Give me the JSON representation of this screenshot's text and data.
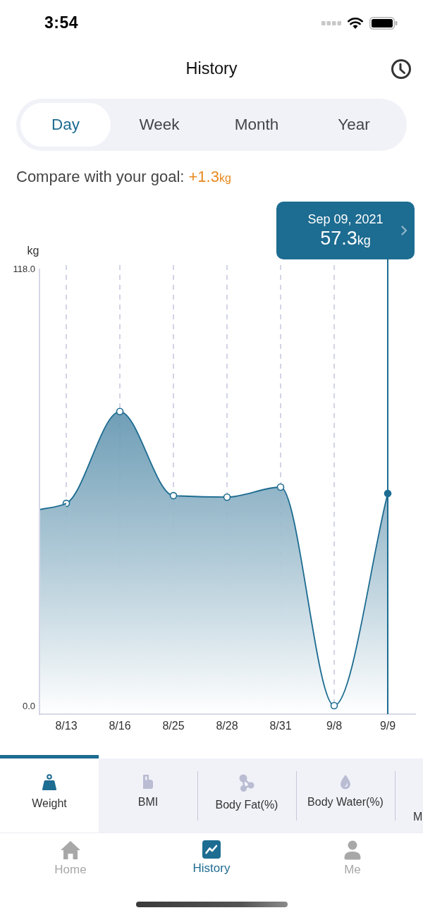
{
  "status_bar": {
    "time": "3:54"
  },
  "header": {
    "title": "History"
  },
  "period_tabs": [
    {
      "label": "Day",
      "selected": true
    },
    {
      "label": "Week",
      "selected": false
    },
    {
      "label": "Month",
      "selected": false
    },
    {
      "label": "Year",
      "selected": false
    }
  ],
  "goal_comparison": {
    "label": "Compare with your goal:",
    "value": "+1.3",
    "unit": "kg"
  },
  "chart": {
    "tooltip": {
      "date": "Sep 09, 2021",
      "value": "57.3",
      "unit": "kg"
    },
    "chart_data": {
      "type": "area",
      "ylabel": "kg",
      "categories": [
        "8/13",
        "8/16",
        "8/25",
        "8/28",
        "8/31",
        "9/8",
        "9/9"
      ],
      "series": [
        {
          "color": "#1d6c91",
          "values": [
            54.6,
            79.4,
            56.7,
            56.3,
            59.0,
            0.0,
            57.3
          ]
        }
      ],
      "ylim": [
        0,
        118
      ],
      "yticks": [
        {
          "value": 0,
          "label": "0.0"
        },
        {
          "value": 118,
          "label": "118.0"
        }
      ],
      "grid": true
    }
  },
  "metric_tabs": [
    {
      "label": "Weight",
      "selected": true
    },
    {
      "label": "BMI",
      "selected": false
    },
    {
      "label": "Body Fat(%)",
      "selected": false
    },
    {
      "label": "Body Water(%)",
      "selected": false
    },
    {
      "label": "M",
      "selected": false
    }
  ],
  "nav": [
    {
      "label": "Home",
      "selected": false
    },
    {
      "label": "History",
      "selected": true
    },
    {
      "label": "Me",
      "selected": false
    }
  ]
}
